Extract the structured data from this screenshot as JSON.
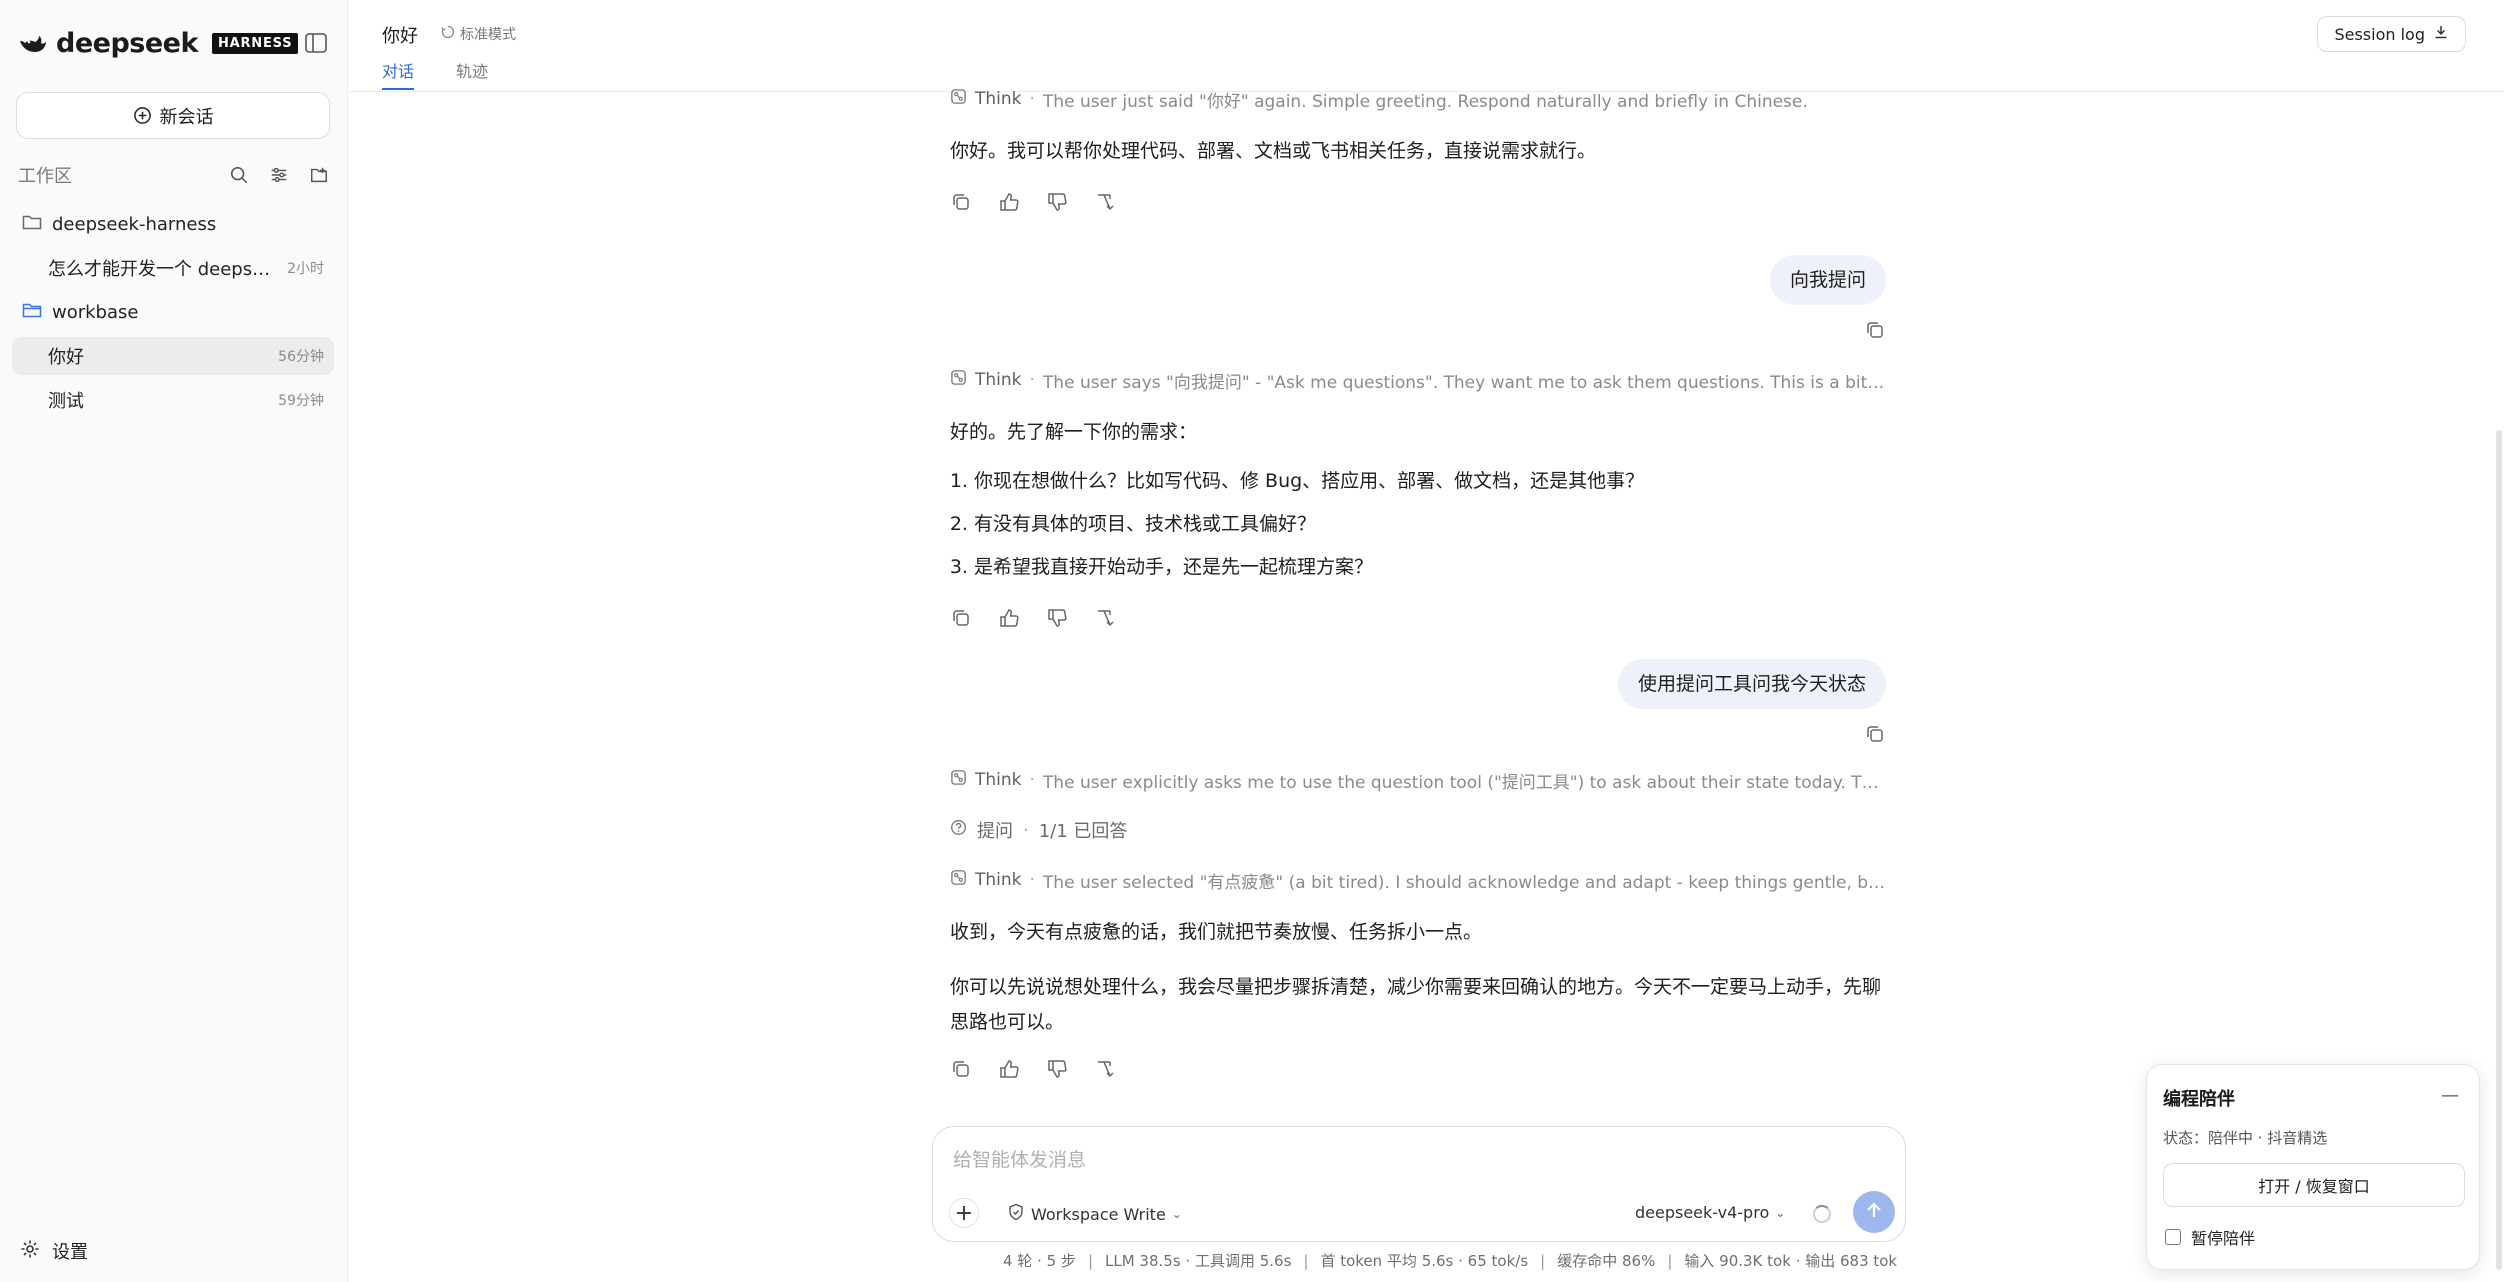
{
  "brand": {
    "name": "deepseek",
    "badge": "HARNESS"
  },
  "sidebar": {
    "new_chat": "新会话",
    "workspace_title": "工作区",
    "folders": [
      {
        "name": "deepseek-harness",
        "items": [
          {
            "title": "怎么才能开发一个 deepseek...",
            "time": "2小时"
          }
        ]
      },
      {
        "name": "workbase",
        "items": [
          {
            "title": "你好",
            "time": "56分钟",
            "active": true
          },
          {
            "title": "测试",
            "time": "59分钟"
          }
        ]
      }
    ],
    "settings": "设置"
  },
  "header": {
    "title": "你好",
    "mode": "标准模式",
    "tabs": [
      "对话",
      "轨迹"
    ],
    "session_log": "Session log"
  },
  "chat": {
    "think1": {
      "label": "Think",
      "text": "The user just said \"你好\" again. Simple greeting. Respond naturally and briefly in Chinese."
    },
    "reply1": "你好。我可以帮你处理代码、部署、文档或飞书相关任务，直接说需求就行。",
    "user1": "向我提问",
    "think2": {
      "label": "Think",
      "text": "The user says \"向我提问\" - \"Ask me questions\". They want me to ask them questions. This is a bit open-end..."
    },
    "reply2_intro": "好的。先了解一下你的需求：",
    "reply2_list": [
      "你现在想做什么？比如写代码、修 Bug、搭应用、部署、做文档，还是其他事？",
      "有没有具体的项目、技术栈或工具偏好？",
      "是希望我直接开始动手，还是先一起梳理方案？"
    ],
    "user2": "使用提问工具问我今天状态",
    "think3": {
      "label": "Think",
      "text": "The user explicitly asks me to use the question tool (\"提问工具\") to ask about their state today. This maps t..."
    },
    "question": {
      "label": "提问",
      "status": "1/1 已回答"
    },
    "think4": {
      "label": "Think",
      "text": "The user selected \"有点疲惫\" (a bit tired). I should acknowledge and adapt - keep things gentle, break tasks..."
    },
    "reply3_p1": "收到，今天有点疲惫的话，我们就把节奏放慢、任务拆小一点。",
    "reply3_p2": "你可以先说说想处理什么，我会尽量把步骤拆清楚，减少你需要来回确认的地方。今天不一定要马上动手，先聊思路也可以。"
  },
  "composer": {
    "placeholder": "给智能体发消息",
    "workspace_mode": "Workspace Write",
    "model": "deepseek-v4-pro"
  },
  "stats": [
    "4 轮 · 5 步",
    "LLM 38.5s · 工具调用 5.6s",
    "首 token 平均 5.6s · 65 tok/s",
    "缓存命中 86%",
    "输入 90.3K tok · 输出 683 tok"
  ],
  "companion": {
    "title": "编程陪伴",
    "status": "状态：陪伴中 · 抖音精选",
    "open_button": "打开 / 恢复窗口",
    "pause_label": "暂停陪伴"
  },
  "colors": {
    "accent": "#2f6bdb",
    "user_bubble": "#eef1fa",
    "send_button": "#9eb7ee"
  }
}
